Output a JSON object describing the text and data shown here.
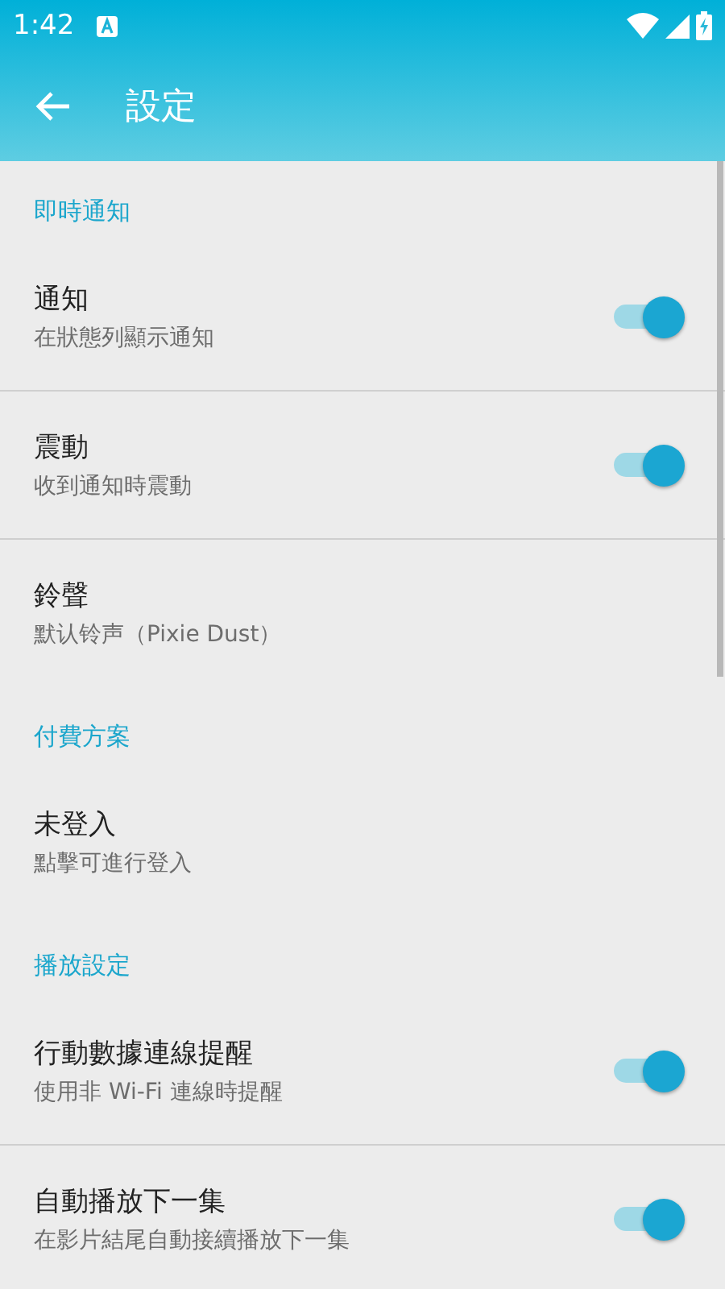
{
  "status_bar": {
    "time": "1:42"
  },
  "app_bar": {
    "title": "設定"
  },
  "sections": [
    {
      "header": "即時通知",
      "items": [
        {
          "kind": "switch",
          "title": "通知",
          "subtitle": "在狀態列顯示通知",
          "on": true
        },
        {
          "kind": "switch",
          "title": "震動",
          "subtitle": "收到通知時震動",
          "on": true
        },
        {
          "kind": "plain",
          "title": "鈴聲",
          "subtitle": "默认铃声（Pixie Dust）"
        }
      ]
    },
    {
      "header": "付費方案",
      "items": [
        {
          "kind": "plain",
          "title": "未登入",
          "subtitle": "點擊可進行登入"
        }
      ]
    },
    {
      "header": "播放設定",
      "items": [
        {
          "kind": "switch",
          "title": "行動數據連線提醒",
          "subtitle": "使用非 Wi-Fi 連線時提醒",
          "on": true
        },
        {
          "kind": "switch",
          "title": "自動播放下一集",
          "subtitle": "在影片結尾自動接續播放下一集",
          "on": true
        }
      ]
    }
  ]
}
